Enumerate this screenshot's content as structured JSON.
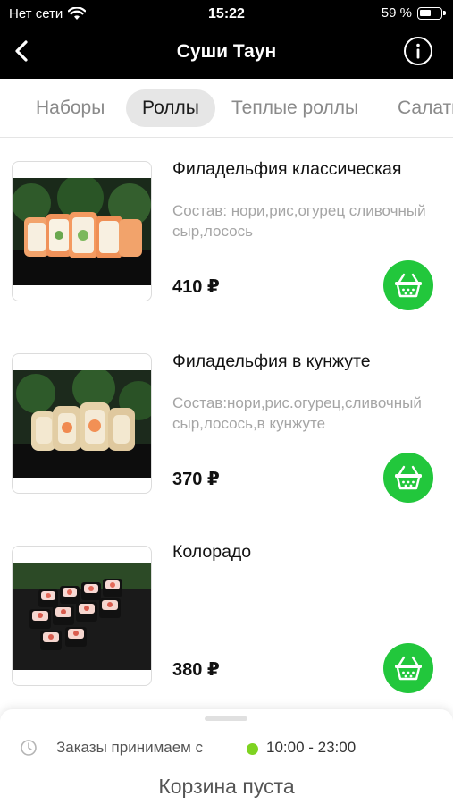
{
  "status_bar": {
    "carrier": "Нет сети",
    "time": "15:22",
    "battery": "59 %",
    "battery_level": 0.59,
    "wifi_icon": "wifi-icon"
  },
  "header": {
    "title": "Суши Таун",
    "back_icon": "chevron-left-icon",
    "info_icon": "info-icon"
  },
  "tabs": [
    {
      "label": "Наборы",
      "active": false
    },
    {
      "label": "Роллы",
      "active": true
    },
    {
      "label": "Теплые роллы",
      "active": false
    },
    {
      "label": "Салаты",
      "active": false
    }
  ],
  "products": [
    {
      "name": "Филадельфия классическая",
      "description": "Состав:  нори,рис,огурец сливочный сыр,лосось",
      "price": "410 ₽"
    },
    {
      "name": "Филадельфия в кунжуте",
      "description": "Состав:нори,рис.огурец,сливочный сыр,лосось,в кунжуте",
      "price": "370 ₽"
    },
    {
      "name": "Колорадо",
      "description": "",
      "price": "380 ₽"
    }
  ],
  "bottom_sheet": {
    "hours_label": "Заказы принимаем с",
    "hours_value": "10:00 - 23:00",
    "cart_status": "Корзина пуста"
  },
  "colors": {
    "accent_green": "#22c73c",
    "open_indicator": "#7ed321",
    "header_bg": "#000000"
  }
}
